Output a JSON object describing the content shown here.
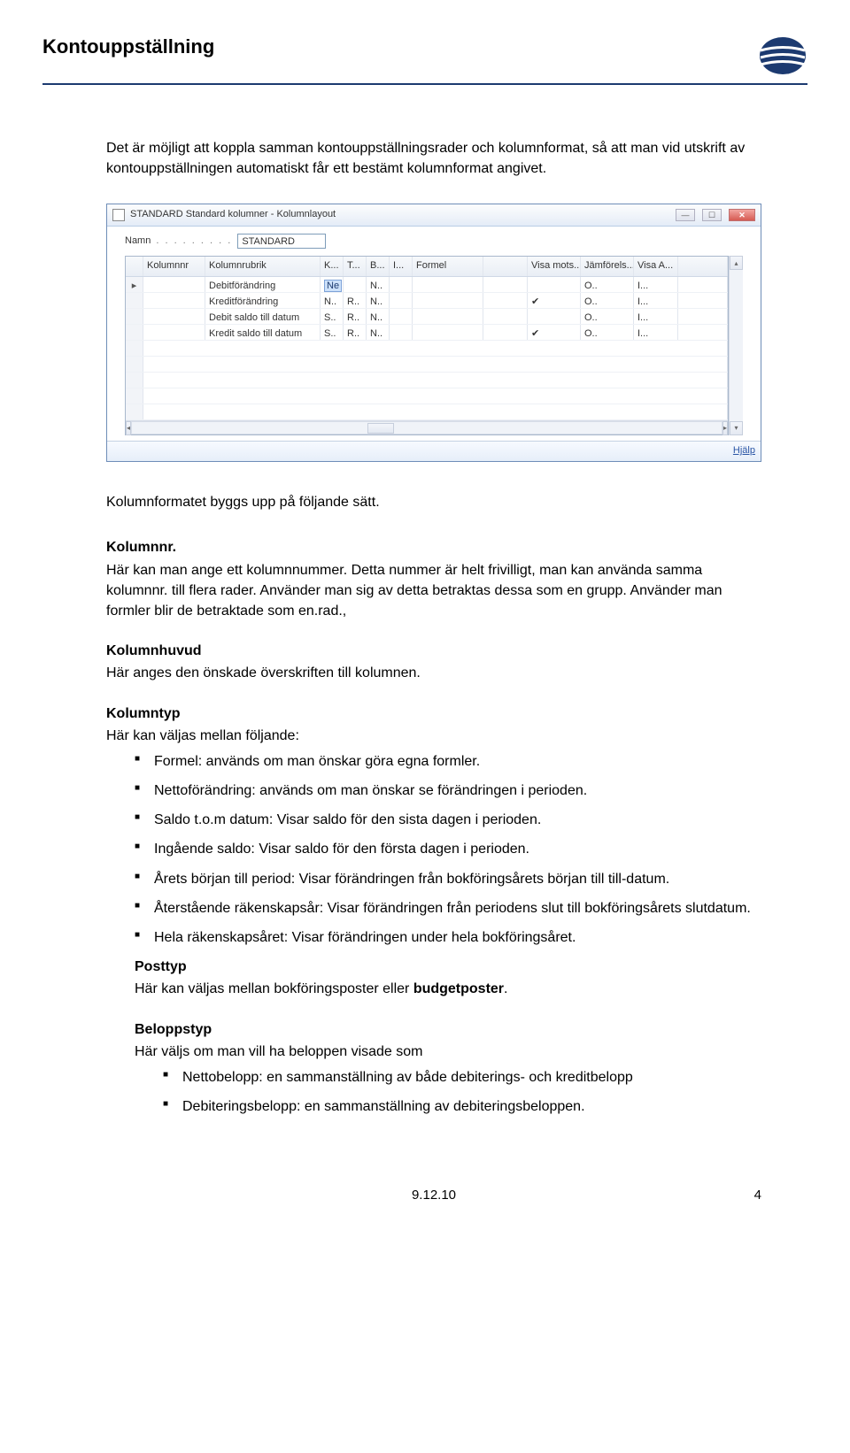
{
  "header": {
    "title": "Kontouppställning"
  },
  "intro": "Det är möjligt att koppla samman kontouppställningsrader och kolumnformat, så att man vid utskrift av kontouppställningen automatiskt får ett bestämt kolumnformat angivet.",
  "window": {
    "title": "STANDARD Standard kolumner - Kolumnlayout",
    "field_label": "Namn",
    "field_dots": ". . . . . . . . .",
    "field_value": "STANDARD",
    "columns": {
      "kolumnnr": "Kolumnnr",
      "kolumnrubrik": "Kolumnrubrik",
      "k": "K...",
      "t": "T...",
      "b": "B...",
      "i": "I...",
      "formel": "Formel",
      "visa": "Visa mots...",
      "jam": "Jämförels...",
      "va": "Visa A..."
    },
    "rows": [
      {
        "mark": "▸",
        "rubrik": "Debitförändring",
        "k": "",
        "ksel": "Ne",
        "t": "",
        "b": "N..",
        "i": "",
        "visa": "",
        "jam": "O..",
        "va": "I..."
      },
      {
        "mark": "",
        "rubrik": "Kreditförändring",
        "k": "N..",
        "t": "R..",
        "b": "N..",
        "i": "",
        "visa": "✔",
        "jam": "O..",
        "va": "I..."
      },
      {
        "mark": "",
        "rubrik": "Debit saldo till datum",
        "k": "S..",
        "t": "R..",
        "b": "N..",
        "i": "",
        "visa": "",
        "jam": "O..",
        "va": "I..."
      },
      {
        "mark": "",
        "rubrik": "Kredit saldo till datum",
        "k": "S..",
        "t": "R..",
        "b": "N..",
        "i": "",
        "visa": "✔",
        "jam": "O..",
        "va": "I..."
      }
    ],
    "help": "Hjälp"
  },
  "text": {
    "byggs": "Kolumnformatet byggs upp på följande sätt.",
    "kolumnnr_h": "Kolumnnr.",
    "kolumnnr_p": "Här kan man ange ett kolumnnummer. Detta nummer är helt frivilligt, man kan använda samma kolumnnr. till flera rader. Använder man sig av detta betraktas dessa som en grupp. Använder man formler blir de betraktade som en.rad.,",
    "kolumnhuvud_h": "Kolumnhuvud",
    "kolumnhuvud_p": "Här anges den önskade överskriften till kolumnen.",
    "kolumntyp_h": "Kolumntyp",
    "kolumntyp_p": "Här kan väljas mellan följande:",
    "bullets1": [
      "Formel: används om man önskar göra egna formler.",
      "Nettoförändring: används om man önskar se förändringen i perioden.",
      "Saldo t.o.m datum: Visar saldo för den sista dagen i perioden.",
      "Ingående saldo: Visar saldo för den första dagen i perioden.",
      "Årets början till period: Visar förändringen från bokföringsårets början till till-datum.",
      "Återstående räkenskapsår: Visar förändringen från periodens slut till bokföringsårets slutdatum.",
      "Hela räkenskapsåret: Visar förändringen under hela bokföringsåret."
    ],
    "posttyp_h": "Posttyp",
    "posttyp_p_pre": "Här kan väljas mellan bokföringsposter eller ",
    "posttyp_p_bold": "budgetposter",
    "beloppstyp_h": "Beloppstyp",
    "beloppstyp_p": "Här väljs om man vill ha beloppen visade som",
    "bullets2": [
      "Nettobelopp: en sammanställning av både debiterings- och kreditbelopp",
      "Debiteringsbelopp: en sammanställning av debiteringsbeloppen."
    ]
  },
  "footer": {
    "date": "9.12.10",
    "page": "4"
  }
}
